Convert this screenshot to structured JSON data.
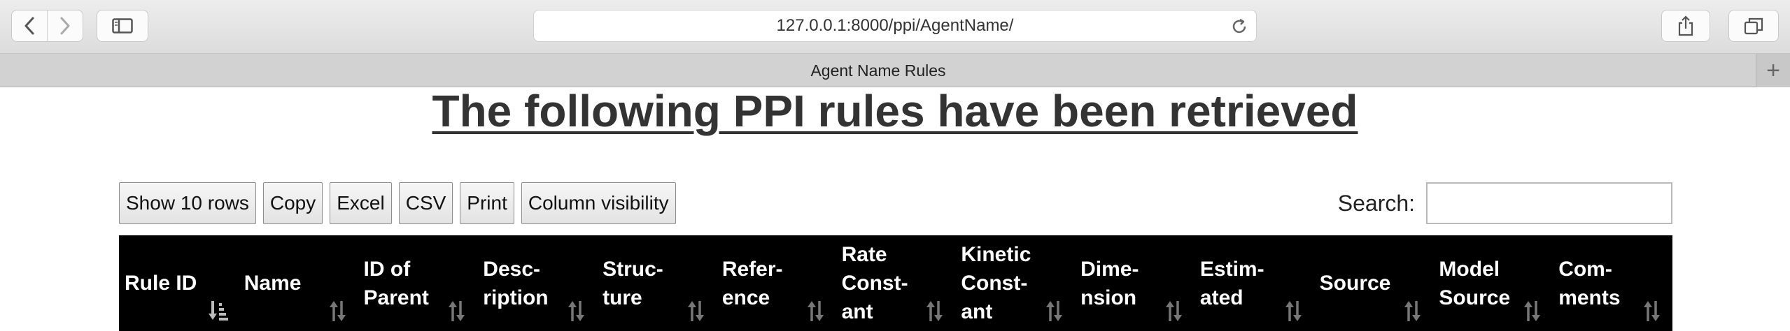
{
  "browser": {
    "url": "127.0.0.1:8000/ppi/AgentName/",
    "tab_title": "Agent Name Rules",
    "new_tab_symbol": "+"
  },
  "page": {
    "heading": "The following PPI rules have been retrieved",
    "buttons": {
      "show_rows": "Show 10 rows",
      "copy": "Copy",
      "excel": "Excel",
      "csv": "CSV",
      "print": "Print",
      "column_visibility": "Column visibility"
    },
    "search": {
      "label": "Search:",
      "value": ""
    },
    "table": {
      "columns": [
        {
          "label": "Rule ID",
          "sort": "ascending"
        },
        {
          "label": "Name",
          "sort": "none"
        },
        {
          "label": "ID of\nParent",
          "sort": "none"
        },
        {
          "label": "Desc-\nription",
          "sort": "none"
        },
        {
          "label": "Struc-\nture",
          "sort": "none"
        },
        {
          "label": "Refer-\nence",
          "sort": "none"
        },
        {
          "label": "Rate\nConst-\nant",
          "sort": "none"
        },
        {
          "label": "Kinetic\nConst-\nant",
          "sort": "none"
        },
        {
          "label": "Dime-\nnsion",
          "sort": "none"
        },
        {
          "label": "Estim-\nated",
          "sort": "none"
        },
        {
          "label": "Source",
          "sort": "none"
        },
        {
          "label": "Model\nSource",
          "sort": "none"
        },
        {
          "label": "Com-\nments",
          "sort": "none"
        }
      ]
    }
  }
}
